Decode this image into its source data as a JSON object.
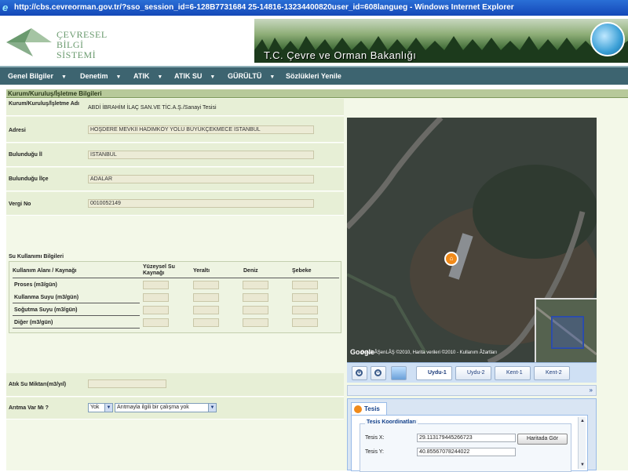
{
  "window": {
    "title": "http://cbs.cevreorman.gov.tr/?sso_session_id=6-128B7731684 25-14816-13234400820user_id=608langueg - Windows Internet Explorer"
  },
  "header": {
    "logo_lines": [
      "ÇEVRESEL",
      "BİLGİ",
      "SİSTEMİ"
    ],
    "banner_title": "T.C. Çevre ve Orman Bakanlığı"
  },
  "nav": {
    "items": [
      "Genel Bilgiler",
      "Denetim",
      "ATIK",
      "ATIK SU",
      "GÜRÜLTÜ",
      "Sözlükleri Yenile"
    ]
  },
  "section": {
    "title": "Kurum/Kuruluş/İşletme Bilgileri"
  },
  "form": {
    "name_label": "Kurum/Kuruluş/İşletme Adı",
    "name_value": "ABDİ İBRAHİM İLAÇ SAN.VE TİC.A.Ş./Sanayi Tesisi",
    "address_label": "Adresi",
    "address_value": "HOŞDERE MEVKİİ HADIMKÖY YOLU BÜYÜKÇEKMECE İSTANBUL",
    "province_label": "Bulunduğu İl",
    "province_value": "İSTANBUL",
    "district_label": "Bulunduğu İlçe",
    "district_value": "ADALAR",
    "tax_label": "Vergi No",
    "tax_value": "0010052149"
  },
  "water": {
    "title": "Su Kullanımı Bilgileri",
    "headers": [
      "Kullanım Alanı / Kaynağı",
      "Yüzeysel Su Kaynağı",
      "Yeraltı",
      "Deniz",
      "Şebeke"
    ],
    "rows": [
      "Proses (m3/gün)",
      "Kullanma Suyu (m3/gün)",
      "Soğutma Suyu (m3/gün)",
      "Diğer (m3/gün)"
    ]
  },
  "wastewater": {
    "amount_label": "Atık Su Miktarı(m3/yıl)",
    "amount_value": "",
    "treatment_label": "Arıtma Var Mı ?",
    "treatment_value": "Yok",
    "treatment_detail": "Arıtmayla ilgili bir çalışma yok"
  },
  "map": {
    "legal": "DAVA ÂŞenLÂŞ ©2010, Harita verileri ©2010 - Kullanım Âžartları",
    "google": "Google",
    "pin_icon": "factory-pin-icon",
    "buttons": [
      "Uydu-1",
      "Uydu-2",
      "Kent-1",
      "Kent-2"
    ],
    "active_button": "Uydu-1"
  },
  "tesis": {
    "tab_label": "Tesis",
    "legend": "Tesis Koordinatları",
    "x_label": "Tesis X:",
    "x_value": "29.113179445266723",
    "y_label": "Tesis Y:",
    "y_value": "40.85567078244022",
    "map_button": "Haritada Gör"
  },
  "colors": {
    "nav_bg": "#3d6470",
    "section_head": "#b7c99a",
    "form_bg": "#f3f8e8",
    "titlebar": "#1f5cc8",
    "accent_blue": "#15428b"
  }
}
